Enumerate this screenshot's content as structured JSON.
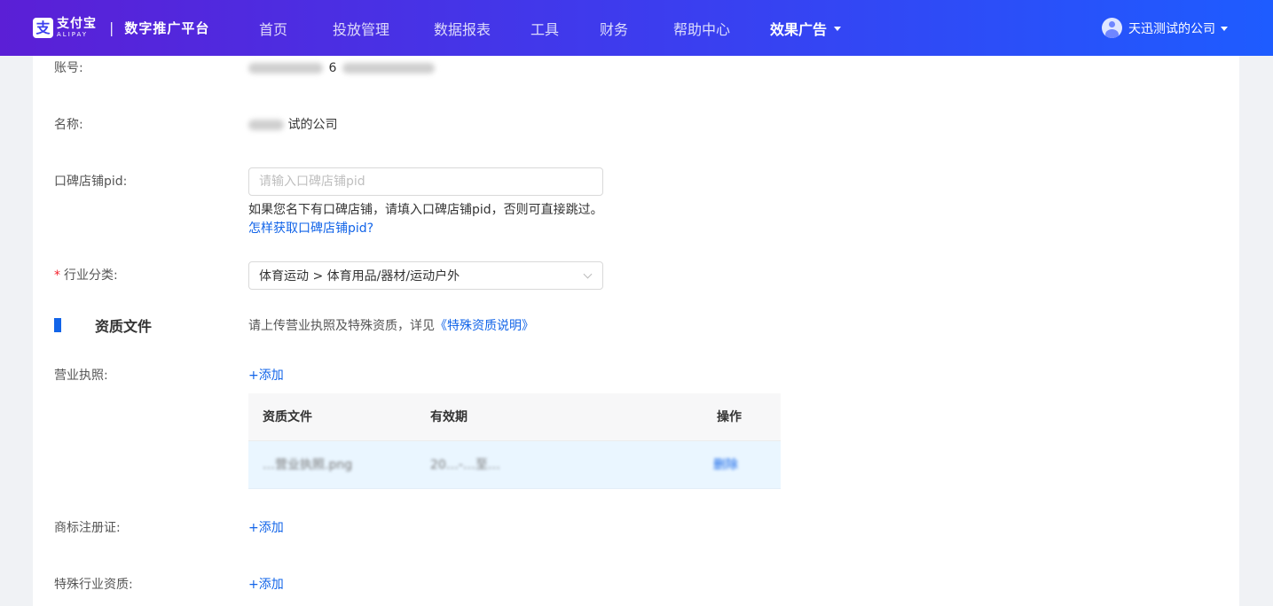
{
  "header": {
    "logo_cn": "支付宝",
    "logo_en": "ALIPAY",
    "separator": "|",
    "platform": "数字推广平台",
    "nav": [
      "首页",
      "投放管理",
      "数据报表",
      "工具",
      "财务",
      "帮助中心",
      "效果广告"
    ],
    "user_name": "天迅测试的公司"
  },
  "form": {
    "account_label": "账号:",
    "account_value_fragment": "6",
    "name_label": "名称:",
    "name_value_fragment": "试的公司",
    "pid_label": "口碑店铺pid:",
    "pid_placeholder": "请输入口碑店铺pid",
    "pid_hint": "如果您名下有口碑店铺，请填入口碑店铺pid，否则可直接跳过。",
    "pid_link": "怎样获取口碑店铺pid?",
    "industry_required": "*",
    "industry_label": "行业分类:",
    "industry_value": "体育运动 > 体育用品/器材/运动户外"
  },
  "qualification": {
    "title": "资质文件",
    "desc": "请上传营业执照及特殊资质，详见",
    "desc_link": "《特殊资质说明》",
    "license_label": "营业执照:",
    "add_label": "+添加",
    "table_headers": [
      "资质文件",
      "有效期",
      "操作"
    ],
    "table_row": {
      "file": "…营业执照.png",
      "validity": "20…-…至…",
      "action": "删除"
    },
    "trademark_label": "商标注册证:",
    "special_label": "特殊行业资质:"
  },
  "colors": {
    "accent": "#1264e8",
    "required": "#f5222d",
    "header_start": "#5b1fd6",
    "header_end": "#1e5cff"
  }
}
